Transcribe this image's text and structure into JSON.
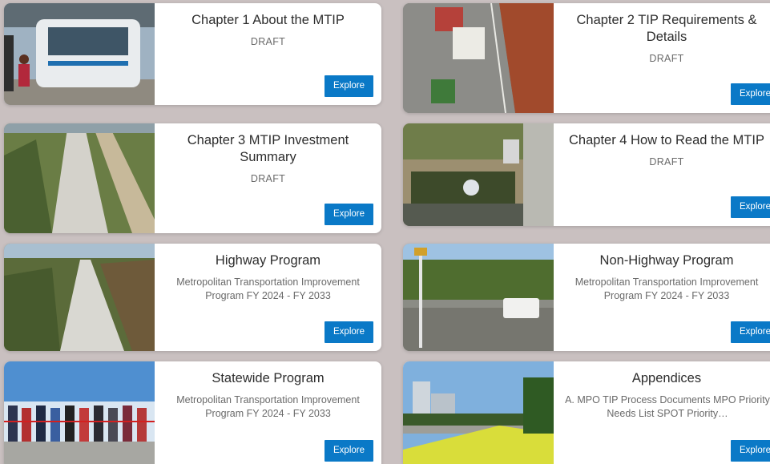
{
  "cards": [
    {
      "title": "Chapter 1 About the MTIP",
      "subtitle": "DRAFT",
      "button": "Explore"
    },
    {
      "title": "Chapter 2 TIP Requirements & Details",
      "subtitle": "DRAFT",
      "button": "Explore"
    },
    {
      "title": "Chapter 3 MTIP Investment Summary",
      "subtitle": "DRAFT",
      "button": "Explore"
    },
    {
      "title": "Chapter 4 How to Read the MTIP",
      "subtitle": "DRAFT",
      "button": "Explore"
    },
    {
      "title": "Highway Program",
      "subtitle": "Metropolitan Transportation Improvement Program FY 2024 - FY 2033",
      "button": "Explore"
    },
    {
      "title": "Non-Highway Program",
      "subtitle": "Metropolitan Transportation Improvement Program FY 2024 - FY 2033",
      "button": "Explore"
    },
    {
      "title": "Statewide Program",
      "subtitle": "Metropolitan Transportation Improvement Program FY 2024 - FY 2033",
      "button": "Explore"
    },
    {
      "title": "Appendices",
      "subtitle": "A.   MPO TIP Process Documents MPO Priority Needs List SPOT Priority…",
      "button": "Explore"
    }
  ],
  "colors": {
    "button": "#0a79c7",
    "background": "#c9c0c0",
    "card": "#ffffff"
  }
}
